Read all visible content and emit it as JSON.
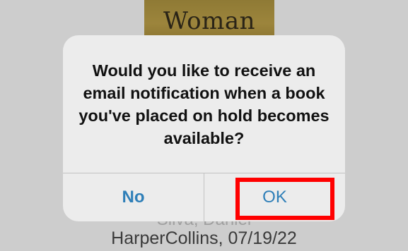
{
  "background": {
    "book_cover_title": "Woman",
    "author_partial": "Silva, Daniel",
    "publisher_line": "HarperCollins, 07/19/22"
  },
  "alert": {
    "message": "Would you like to receive an email notification when a book you've placed on hold becomes available?",
    "buttons": {
      "no_label": "No",
      "ok_label": "OK"
    }
  },
  "colors": {
    "accent": "#2f7fb8",
    "highlight": "#ff0000",
    "alert_bg": "#ececec",
    "backdrop": "#cdcdcd"
  }
}
